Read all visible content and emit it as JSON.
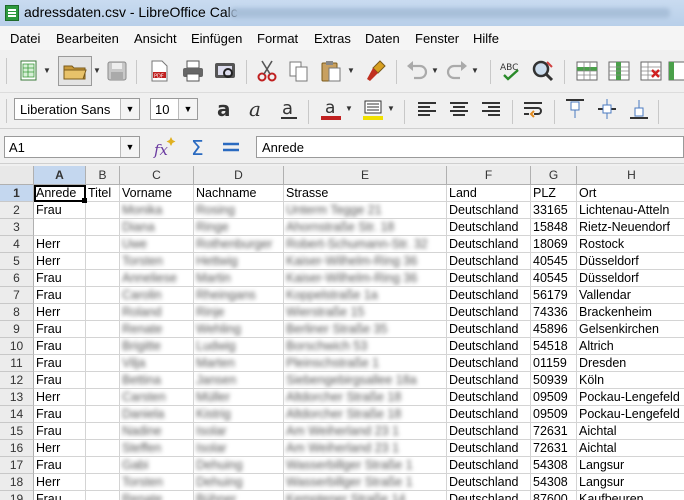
{
  "window": {
    "title": "adressdaten.csv - LibreOffice Calc"
  },
  "menu": [
    "Datei",
    "Bearbeiten",
    "Ansicht",
    "Einfügen",
    "Format",
    "Extras",
    "Daten",
    "Fenster",
    "Hilfe"
  ],
  "formatting": {
    "font_name": "Liberation Sans",
    "font_size": "10"
  },
  "formula_bar": {
    "name_box": "A1",
    "content": "Anrede"
  },
  "columns": [
    "A",
    "B",
    "C",
    "D",
    "E",
    "F",
    "G",
    "H"
  ],
  "rows": [
    "1",
    "2",
    "3",
    "4",
    "5",
    "6",
    "7",
    "8",
    "9",
    "10",
    "11",
    "12",
    "13",
    "14",
    "15",
    "16",
    "17",
    "18",
    "19"
  ],
  "header_row": [
    "Anrede",
    "Titel",
    "Vorname",
    "Nachname",
    "Strasse",
    "Land",
    "PLZ",
    "Ort"
  ],
  "data_rows": [
    {
      "anrede": "Frau",
      "vorname": "Monika",
      "nachname": "Rosing",
      "strasse": "Unterm Tegge 21",
      "land": "Deutschland",
      "plz": "33165",
      "ort": "Lichtenau-Atteln"
    },
    {
      "anrede": "",
      "vorname": "Diana",
      "nachname": "Ringe",
      "strasse": "Ahornstraße Str. 18",
      "land": "Deutschland",
      "plz": "15848",
      "ort": "Rietz-Neuendorf"
    },
    {
      "anrede": "Herr",
      "vorname": "Uwe",
      "nachname": "Rothenburger",
      "strasse": "Robert-Schumann-Str. 32",
      "land": "Deutschland",
      "plz": "18069",
      "ort": "Rostock"
    },
    {
      "anrede": "Herr",
      "vorname": "Torsten",
      "nachname": "Hettwig",
      "strasse": "Kaiser-Wilhelm-Ring 36",
      "land": "Deutschland",
      "plz": "40545",
      "ort": "Düsseldorf"
    },
    {
      "anrede": "Frau",
      "vorname": "Anneliese",
      "nachname": "Martin",
      "strasse": "Kaiser-Wilhelm-Ring 36",
      "land": "Deutschland",
      "plz": "40545",
      "ort": "Düsseldorf"
    },
    {
      "anrede": "Frau",
      "vorname": "Carolin",
      "nachname": "Rheingans",
      "strasse": "Koppelstraße 1a",
      "land": "Deutschland",
      "plz": "56179",
      "ort": "Vallendar"
    },
    {
      "anrede": "Herr",
      "vorname": "Roland",
      "nachname": "Rinje",
      "strasse": "Wierstraße 15",
      "land": "Deutschland",
      "plz": "74336",
      "ort": "Brackenheim"
    },
    {
      "anrede": "Frau",
      "vorname": "Renate",
      "nachname": "Wehling",
      "strasse": "Berliner Straße 35",
      "land": "Deutschland",
      "plz": "45896",
      "ort": "Gelsenkirchen"
    },
    {
      "anrede": "Frau",
      "vorname": "Brigitte",
      "nachname": "Ludwig",
      "strasse": "Borschwich 53",
      "land": "Deutschland",
      "plz": "54518",
      "ort": "Altrich"
    },
    {
      "anrede": "Frau",
      "vorname": "Vilja",
      "nachname": "Marten",
      "strasse": "Pleinschstraße 1",
      "land": "Deutschland",
      "plz": "01159",
      "ort": "Dresden"
    },
    {
      "anrede": "Frau",
      "vorname": "Bettina",
      "nachname": "Jansen",
      "strasse": "Siebengebirgsallee 18a",
      "land": "Deutschland",
      "plz": "50939",
      "ort": "Köln"
    },
    {
      "anrede": "Herr",
      "vorname": "Carsten",
      "nachname": "Müller",
      "strasse": "Altdorcher Straße 18",
      "land": "Deutschland",
      "plz": "09509",
      "ort": "Pockau-Lengefeld"
    },
    {
      "anrede": "Frau",
      "vorname": "Daniela",
      "nachname": "Kistrig",
      "strasse": "Altdorcher Straße 18",
      "land": "Deutschland",
      "plz": "09509",
      "ort": "Pockau-Lengefeld"
    },
    {
      "anrede": "Frau",
      "vorname": "Nadine",
      "nachname": "Isolar",
      "strasse": "Am Weiherland 23 1",
      "land": "Deutschland",
      "plz": "72631",
      "ort": "Aichtal"
    },
    {
      "anrede": "Herr",
      "vorname": "Steffen",
      "nachname": "Isolar",
      "strasse": "Am Weiherland 23 1",
      "land": "Deutschland",
      "plz": "72631",
      "ort": "Aichtal"
    },
    {
      "anrede": "Frau",
      "vorname": "Gabi",
      "nachname": "Dehuing",
      "strasse": "Wasserbillger Straße 1",
      "land": "Deutschland",
      "plz": "54308",
      "ort": "Langsur"
    },
    {
      "anrede": "Herr",
      "vorname": "Torsten",
      "nachname": "Dehuing",
      "strasse": "Wasserbillger Straße 1",
      "land": "Deutschland",
      "plz": "54308",
      "ort": "Langsur"
    },
    {
      "anrede": "Frau",
      "vorname": "Renate",
      "nachname": "Bühner",
      "strasse": "Kemptener Straße 14",
      "land": "Deutschland",
      "plz": "87600",
      "ort": "Kaufbeuren"
    }
  ]
}
